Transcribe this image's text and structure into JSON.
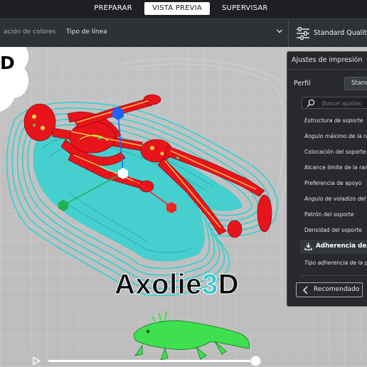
{
  "nav": {
    "tabs": [
      {
        "label": "PREPARAR",
        "active": false
      },
      {
        "label": "VISTA PREVIA",
        "active": true
      },
      {
        "label": "SUPERVISAR",
        "active": false
      }
    ]
  },
  "view_bar": {
    "color_mode_label": "ación de colores",
    "color_mode_value": "Tipo de línea",
    "quality_label": "Standard Quality - "
  },
  "overlay": {
    "cloud_text": "D",
    "watermark": {
      "part1": "Axolie",
      "part2": "3",
      "part3": "D"
    }
  },
  "settings_panel": {
    "title": "Ajustes de impresión",
    "profile_label": "Perfil",
    "profile_value": "Standa",
    "search_placeholder": "Buscar ajustes",
    "items": [
      {
        "label": "Estructura de soporte",
        "italic": true
      },
      {
        "label": "Ángulo máximo de la rama",
        "italic": true
      },
      {
        "label": "Colocación del soporte",
        "italic": false
      },
      {
        "label": "Alcance límite de la rama",
        "italic": false
      },
      {
        "label": "Preferencia de apoyo",
        "italic": false
      },
      {
        "label": "Ángulo de voladizo del sop",
        "italic": true
      },
      {
        "label": "Patrón del soporte",
        "italic": false
      },
      {
        "label": "Densidad del soporte",
        "italic": false
      }
    ],
    "section_label": "Adherencia de la",
    "adhesion_type_label": "Tipo adherencia de la plac",
    "recommended_label": "Recomendado"
  },
  "playback": {
    "progress": 1.0
  },
  "colors": {
    "top_bar": "#1d1f22",
    "panel_bg": "#27292c",
    "wall_red": "#e8141c",
    "support_cyan": "#2fd1d1",
    "infill_yellow": "#f2e94a",
    "axolotl_green": "#3ee04f",
    "watermark_accent": "#2ec7d0"
  },
  "icons": [
    "sliders-icon",
    "chevron-down-icon",
    "search-icon",
    "download-icon",
    "chevron-left-icon",
    "play-icon"
  ]
}
